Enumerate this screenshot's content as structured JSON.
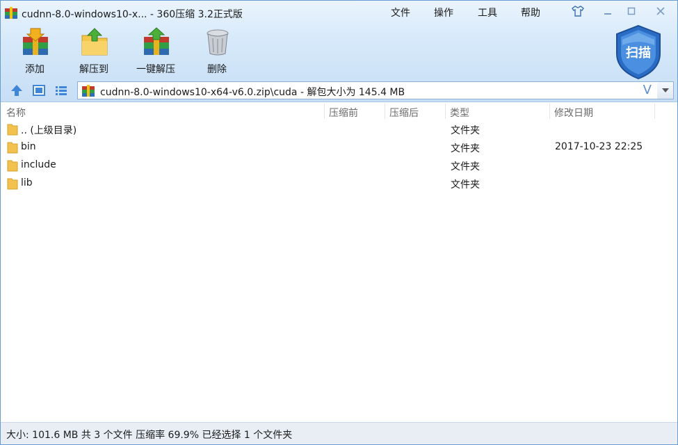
{
  "window": {
    "title": "cudnn-8.0-windows10-x... - 360压缩 3.2正式版",
    "menus": [
      "文件",
      "操作",
      "工具",
      "帮助"
    ]
  },
  "toolbar": {
    "add": "添加",
    "extract_to": "解压到",
    "one_click_extract": "一键解压",
    "delete": "删除",
    "scan": "扫描"
  },
  "address": {
    "path": "cudnn-8.0-windows10-x64-v6.0.zip\\cuda - 解包大小为 145.4 MB",
    "dropdown_glyph": "V"
  },
  "columns": {
    "name": "名称",
    "packed": "压缩前",
    "unpacked": "压缩后",
    "type": "类型",
    "modified": "修改日期"
  },
  "files": [
    {
      "name": ".. (上级目录)",
      "type": "文件夹",
      "modified": ""
    },
    {
      "name": "bin",
      "type": "文件夹",
      "modified": "2017-10-23 22:25"
    },
    {
      "name": "include",
      "type": "文件夹",
      "modified": ""
    },
    {
      "name": "lib",
      "type": "文件夹",
      "modified": ""
    }
  ],
  "status": {
    "text": "大小: 101.6 MB 共 3 个文件 压缩率 69.9% 已经选择 1 个文件夹"
  },
  "colors": {
    "accent": "#2f6fc0",
    "folder": "#f2c14e",
    "scan_shield": "#3e82d6"
  }
}
